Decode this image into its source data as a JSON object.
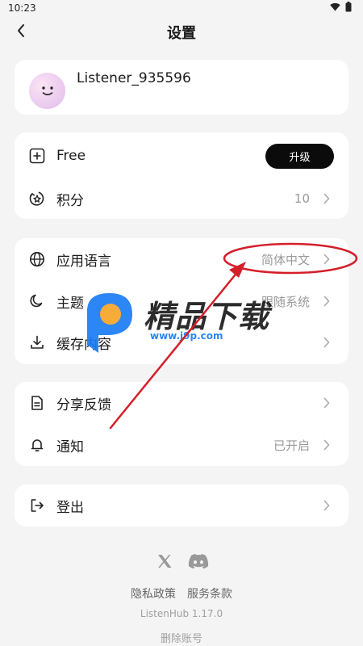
{
  "status": {
    "time": "10:23"
  },
  "header": {
    "title": "设置"
  },
  "profile": {
    "username": "Listener_935596"
  },
  "plan": {
    "name": "Free",
    "upgrade_label": "升级"
  },
  "points": {
    "label": "积分",
    "value": "10"
  },
  "language": {
    "label": "应用语言",
    "value": "简体中文"
  },
  "theme": {
    "label": "主题",
    "value": "跟随系统"
  },
  "cache": {
    "label": "缓存内容"
  },
  "feedback": {
    "label": "分享反馈"
  },
  "notifications": {
    "label": "通知",
    "value": "已开启"
  },
  "logout": {
    "label": "登出"
  },
  "footer": {
    "privacy": "隐私政策",
    "terms": "服务条款",
    "version": "ListenHub 1.17.0",
    "delete_account": "删除账号"
  },
  "watermark": {
    "title": "精品下载",
    "url": "www.j9p.com"
  },
  "colors": {
    "annotation": "#d41f2a",
    "upgrade_bg": "#0b0b0b",
    "watermark_blue": "#1b7cf5",
    "watermark_orange": "#f7a529"
  }
}
